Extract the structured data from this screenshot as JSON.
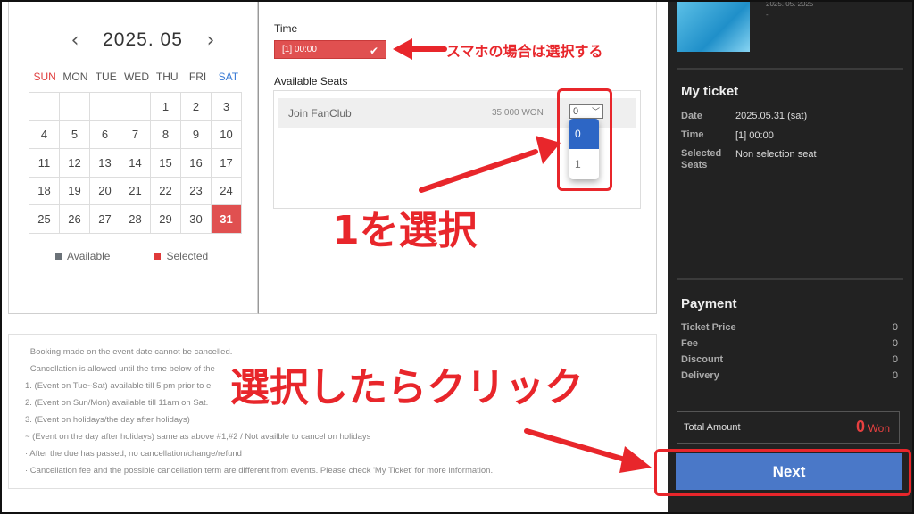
{
  "calendar": {
    "prev_icon": "‹",
    "next_icon": "›",
    "title": "2025. 05",
    "weekdays": [
      "SUN",
      "MON",
      "TUE",
      "WED",
      "THU",
      "FRI",
      "SAT"
    ],
    "days": [
      "",
      "",
      "",
      "",
      "1",
      "2",
      "3",
      "4",
      "5",
      "6",
      "7",
      "8",
      "9",
      "10",
      "11",
      "12",
      "13",
      "14",
      "15",
      "16",
      "17",
      "18",
      "19",
      "20",
      "21",
      "22",
      "23",
      "24",
      "25",
      "26",
      "27",
      "28",
      "29",
      "30",
      "31"
    ],
    "selected_day": "31",
    "legend": [
      {
        "label": "Available",
        "color": "#6b7278"
      },
      {
        "label": "Selected",
        "color": "#e03a3a"
      }
    ]
  },
  "booking": {
    "time_label": "Time",
    "time_value": "[1] 00:00",
    "seats_label": "Available Seats",
    "seat": {
      "name": "Join FanClub",
      "price": "35,000 WON",
      "qty": "0"
    },
    "qty_options": [
      "0",
      "1"
    ]
  },
  "notice": [
    "· Booking made on the event date cannot be cancelled.",
    "· Cancellation is allowed until the time below of the",
    "  1. (Event on Tue~Sat) available till 5 pm prior to e",
    "  2. (Event on Sun/Mon) available till 11am on Sat.",
    "  3. (Event on holidays/the day after holidays)",
    "  ~ (Event on the day after holidays) same as above #1,#2 / Not availble to cancel on holidays",
    "· After the due has passed, no cancellation/change/refund",
    "· Cancellation fee and the possible cancellation term are different from events. Please check 'My Ticket' for more information."
  ],
  "sidebar": {
    "poster_text": "2025. 05. 2025",
    "poster_dash": "-",
    "my_ticket": {
      "heading": "My ticket",
      "date_key": "Date",
      "date_val": "2025.05.31 (sat)",
      "time_key": "Time",
      "time_val": "[1] 00:00",
      "seats_key": "Selected Seats",
      "seats_val": "Non selection seat"
    },
    "payment": {
      "heading": "Payment",
      "rows": [
        {
          "key": "Ticket Price",
          "val": "0"
        },
        {
          "key": "Fee",
          "val": "0"
        },
        {
          "key": "Discount",
          "val": "0"
        },
        {
          "key": "Delivery",
          "val": "0"
        }
      ]
    },
    "total_label": "Total Amount",
    "total_amount": "0",
    "total_currency": "Won",
    "next_label": "Next"
  },
  "annotations": {
    "phone_note": "スマホの場合は選択する",
    "select_one": "1を選択",
    "click_after": "選択したらクリック",
    "color": "#e8262b"
  }
}
